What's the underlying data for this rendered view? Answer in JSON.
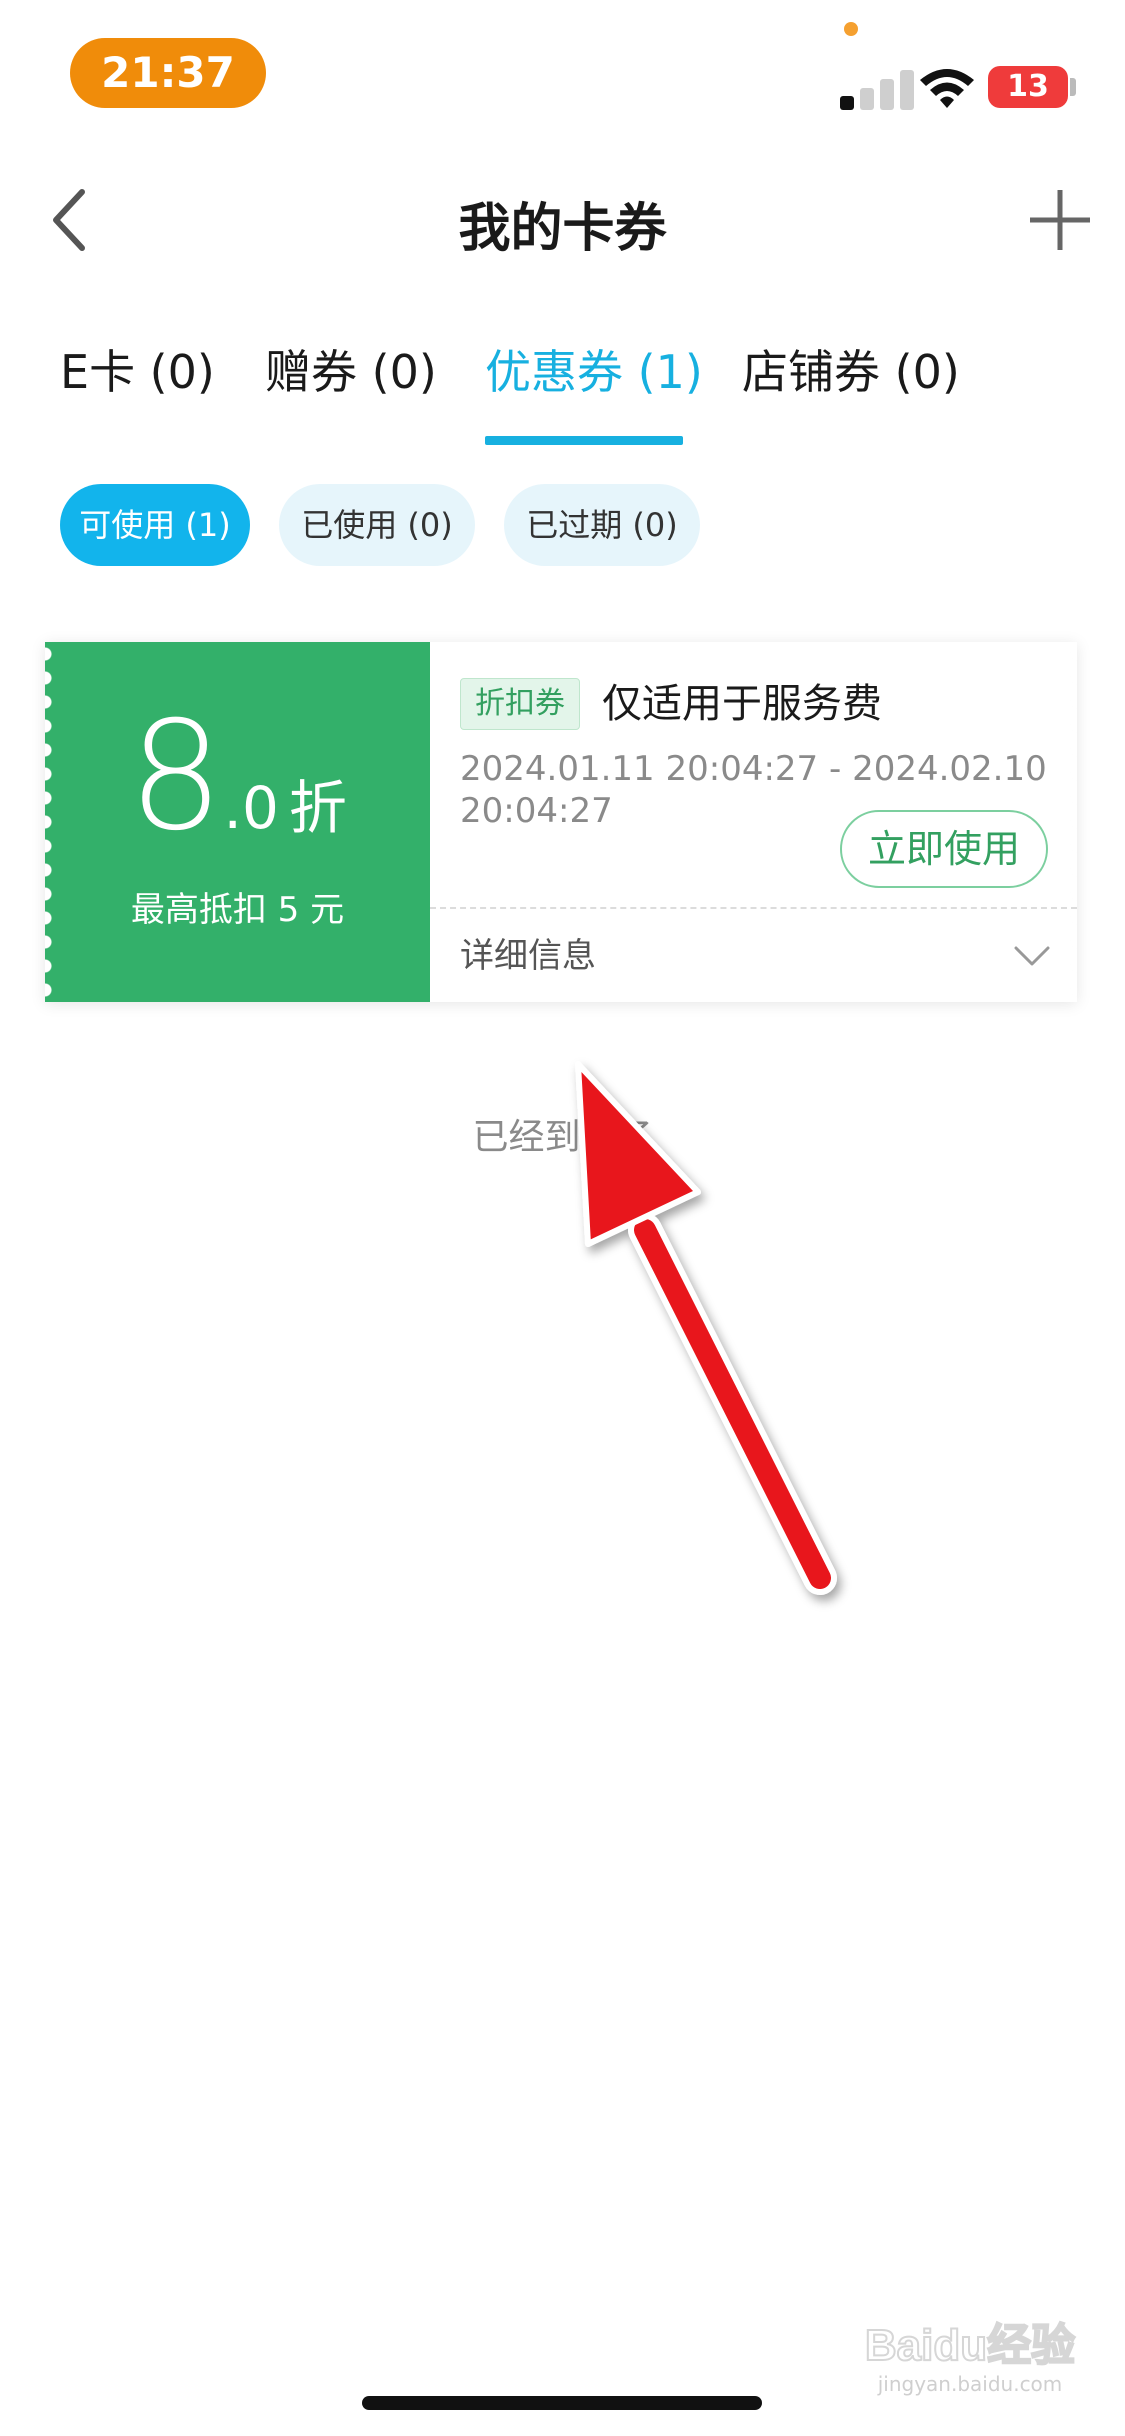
{
  "status_bar": {
    "time": "21:37",
    "battery": "13",
    "icons": [
      "signal-icon",
      "wifi-icon",
      "battery-charging-icon"
    ]
  },
  "nav": {
    "title": "我的卡券",
    "back_icon": "chevron-left-icon",
    "add_icon": "plus-icon"
  },
  "tabs": [
    {
      "label": "E卡 (0)",
      "active": false
    },
    {
      "label": "赠券 (0)",
      "active": false
    },
    {
      "label": "优惠券 (1)",
      "active": true
    },
    {
      "label": "店铺券 (0)",
      "active": false
    }
  ],
  "filters": [
    {
      "label": "可使用 (1)",
      "active": true
    },
    {
      "label": "已使用 (0)",
      "active": false
    },
    {
      "label": "已过期 (0)",
      "active": false
    }
  ],
  "coupon": {
    "discount_int": "8",
    "discount_dec": ".0",
    "discount_unit": "折",
    "max_deduct": "最高抵扣 5 元",
    "type_tag": "折扣券",
    "title": "仅适用于服务费",
    "validity": "2024.01.11 20:04:27 - 2024.02.10 20:04:27",
    "use_button": "立即使用",
    "details_label": "详细信息",
    "accent_color": "#33b06a"
  },
  "list_end_note": "已经到底了",
  "colors": {
    "primary": "#17b0e0",
    "coupon_green": "#33b06a",
    "time_pill": "#f08c0a",
    "annotation_arrow": "#e8141b"
  },
  "watermark": {
    "logo": "Baidu经验",
    "url": "jingyan.baidu.com"
  }
}
